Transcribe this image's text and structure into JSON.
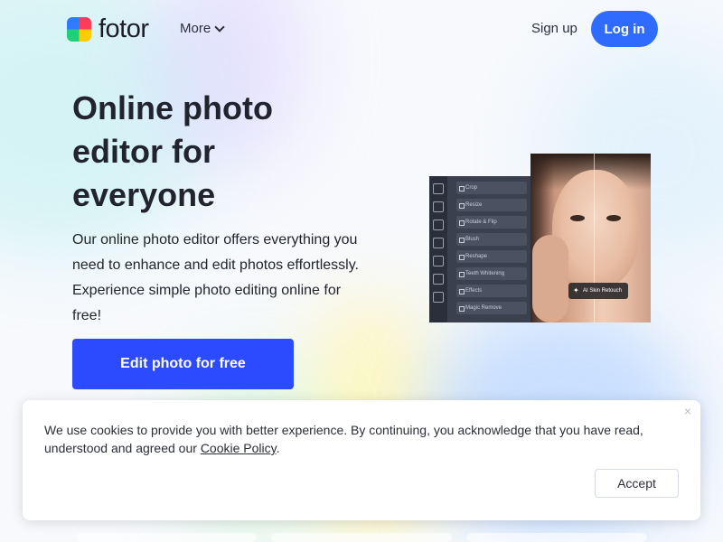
{
  "header": {
    "logo_text": "fotor",
    "more_label": "More",
    "signup_label": "Sign up",
    "login_label": "Log in"
  },
  "hero": {
    "title": "Online photo editor for everyone",
    "subtitle": "Our online photo editor offers everything you need to enhance and edit photos effortlessly. Experience simple photo editing online for free!",
    "cta_label": "Edit photo for free"
  },
  "editor_preview": {
    "menu_items": [
      "Crop",
      "Resize",
      "Rotate & Flip",
      "Blush",
      "Reshape",
      "Teeth Whitening",
      "Effects",
      "Magic Remove"
    ],
    "badge_label": "AI Skin Retouch"
  },
  "cookie_banner": {
    "text_before_link": "We use cookies to provide you with better experience. By continuing, you acknowledge that you have read, understood and agreed our ",
    "policy_link": "Cookie Policy",
    "text_after_link": ".",
    "accept_label": "Accept",
    "close_icon": "×"
  },
  "colors": {
    "primary_button": "#2c4bff",
    "login_button": "#2f6bff"
  }
}
